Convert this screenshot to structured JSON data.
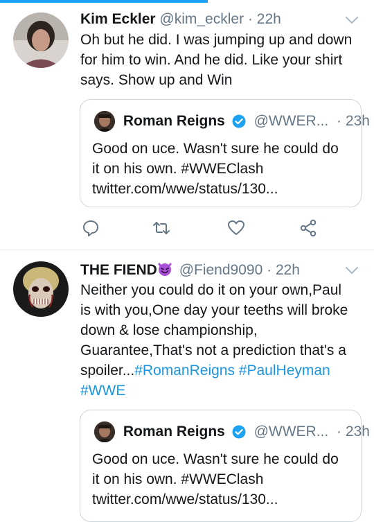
{
  "tweets": [
    {
      "name": "Kim Eckler",
      "handle": "@kim_eckler",
      "separator": "·",
      "time": "22h",
      "text_lines": [
        "Oh but he did. I was jumping up and down",
        "for him to win. And he did. Like your shirt",
        "says. Show up and Win"
      ],
      "quote": {
        "name": "Roman Reigns",
        "handle": "@WWER...",
        "separator": "·",
        "time": "23h",
        "text_lines": [
          "Good on uce. Wasn't sure he could do",
          "it on his own. #WWEClash",
          "twitter.com/wwe/status/130..."
        ]
      }
    },
    {
      "name": "THE FIEND",
      "name_emoji": "😈",
      "handle": "@Fiend9090",
      "separator": "·",
      "time": "22h",
      "text_lines": [
        "Neither you could do it on your own,Paul",
        "is with you,One day your teeths will broke",
        "down & lose championship,",
        "Guarantee,That's not a prediction that's a"
      ],
      "text_line5_plain": "spoiler...",
      "hashtags": [
        "#RomanReigns",
        "#PaulHeyman",
        "#WWE"
      ],
      "quote": {
        "name": "Roman Reigns",
        "handle": "@WWER...",
        "separator": "·",
        "time": "23h",
        "text_lines": [
          "Good on uce. Wasn't sure he could do",
          "it on his own. #WWEClash",
          "twitter.com/wwe/status/130..."
        ]
      }
    }
  ],
  "icons": [
    "reply-icon",
    "retweet-icon",
    "like-icon",
    "share-icon",
    "verified-icon",
    "chevron-down-icon"
  ],
  "colors": {
    "accent": "#1da1f2",
    "hashtag": "#1b95e0",
    "muted": "#657786",
    "text": "#14171a",
    "border": "#ccd6dd",
    "devil_emoji": "#a74fd6"
  }
}
